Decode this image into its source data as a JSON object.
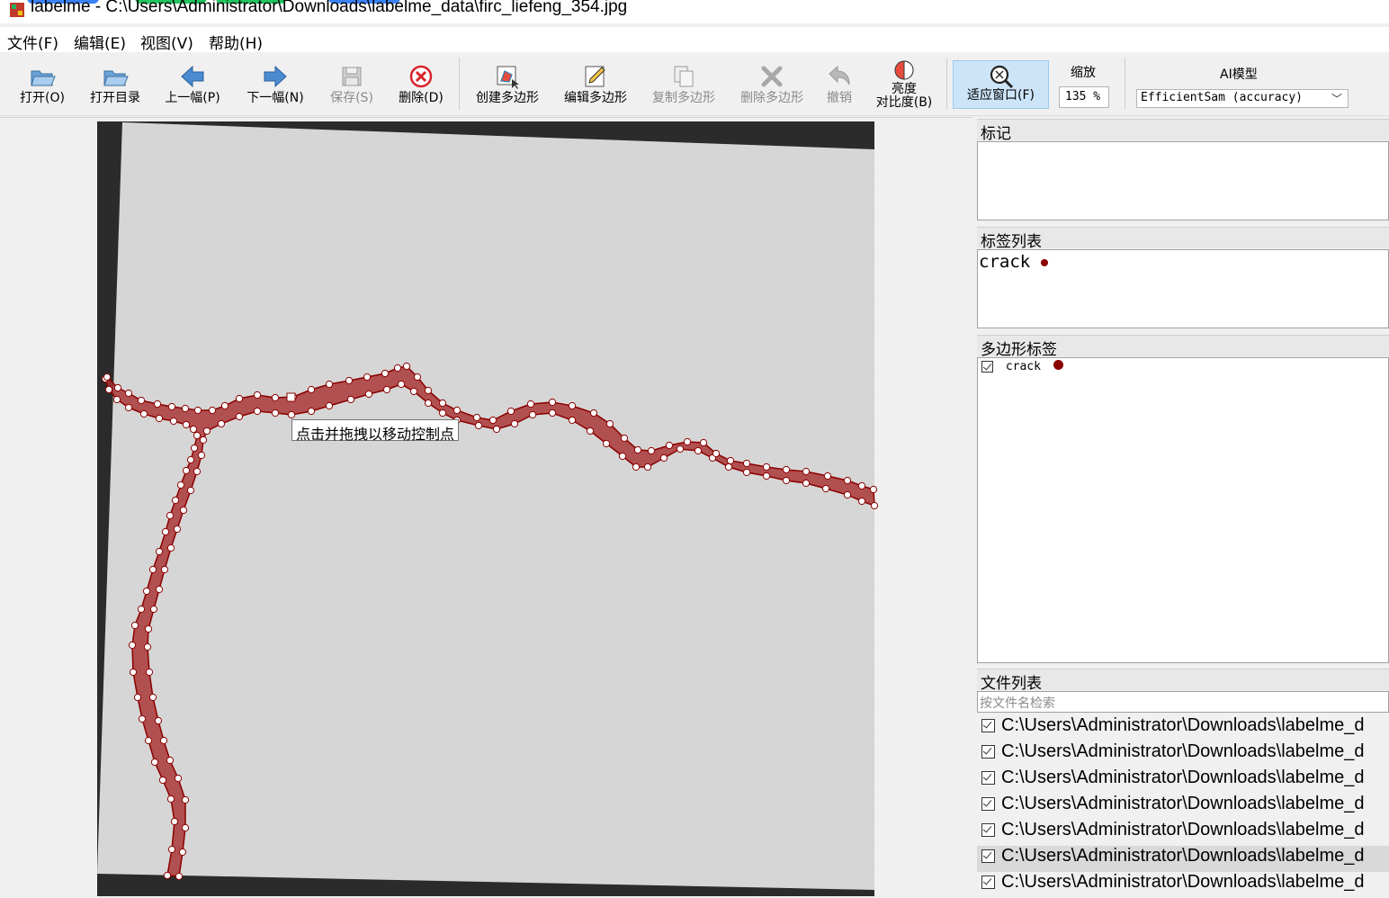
{
  "window": {
    "title": "labelme - C:\\Users\\Administrator\\Downloads\\labelme_data\\firc_liefeng_354.jpg"
  },
  "menu": {
    "items": [
      "文件(F)",
      "编辑(E)",
      "视图(V)",
      "帮助(H)"
    ]
  },
  "toolbar": {
    "open": "打开(O)",
    "open_dir": "打开目录",
    "prev": "上一幅(P)",
    "next": "下一幅(N)",
    "save": "保存(S)",
    "delete": "删除(D)",
    "create_polygon": "创建多边形",
    "edit_polygon": "编辑多边形",
    "copy_polygon": "复制多边形",
    "delete_polygon": "删除多边形",
    "undo": "撤销",
    "brightness_line1": "亮度",
    "brightness_line2": "对比度(B)",
    "fit_window": "适应窗口(F)",
    "zoom_label": "缩放",
    "zoom_value": "135 %",
    "ai_label": "AI模型",
    "ai_model": "EfficientSam (accuracy)"
  },
  "canvas": {
    "tooltip": "点击并拖拽以移动控制点",
    "colors": {
      "polygon_fill": "#a83232",
      "polygon_stroke": "#8b0000",
      "vertex": "#ffffff",
      "border": "#2b2b2b",
      "paper": "#d9d9d9"
    }
  },
  "docks": {
    "flags_title": "标记",
    "label_list_title": "标签列表",
    "label_list": [
      {
        "name": "crack",
        "color": "#8b0000"
      }
    ],
    "polygon_labels_title": "多边形标签",
    "polygon_labels": [
      {
        "name": "crack",
        "color": "#8b0000",
        "checked": true
      }
    ],
    "file_list_title": "文件列表",
    "file_search_placeholder": "按文件名检索",
    "files": [
      "C:\\Users\\Administrator\\Downloads\\labelme_d",
      "C:\\Users\\Administrator\\Downloads\\labelme_d",
      "C:\\Users\\Administrator\\Downloads\\labelme_d",
      "C:\\Users\\Administrator\\Downloads\\labelme_d",
      "C:\\Users\\Administrator\\Downloads\\labelme_d",
      "C:\\Users\\Administrator\\Downloads\\labelme_d",
      "C:\\Users\\Administrator\\Downloads\\labelme_d"
    ],
    "selected_file_index": 5
  }
}
